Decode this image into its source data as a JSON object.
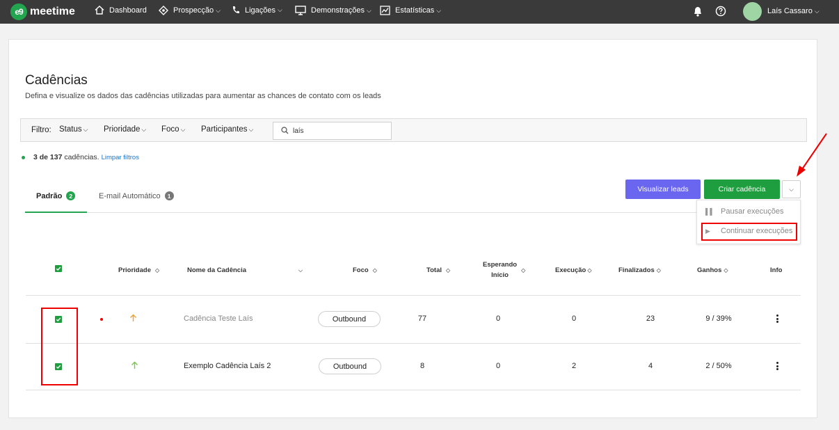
{
  "brand": {
    "logo_mark": "e9",
    "name": "meetime",
    "color": "#22a54e"
  },
  "nav": {
    "items": [
      {
        "label": "Dashboard",
        "icon": "home-icon",
        "has_dropdown": false
      },
      {
        "label": "Prospecção",
        "icon": "compass-icon",
        "has_dropdown": true
      },
      {
        "label": "Ligações",
        "icon": "phone-icon",
        "has_dropdown": true
      },
      {
        "label": "Demonstrações",
        "icon": "monitor-icon",
        "has_dropdown": true
      },
      {
        "label": "Estatísticas",
        "icon": "chart-icon",
        "has_dropdown": true
      }
    ],
    "user_name": "Laís Cassaro"
  },
  "page": {
    "title": "Cadências",
    "subtitle": "Defina e visualize os dados das cadências utilizadas para aumentar as chances de contato com os leads"
  },
  "filters": {
    "label": "Filtro:",
    "dropdowns": [
      "Status",
      "Prioridade",
      "Foco",
      "Participantes"
    ],
    "search_value": "laís"
  },
  "results": {
    "count_bold": "3 de 137",
    "count_text": " cadências.",
    "clear_link": "Limpar filtros"
  },
  "tabs": [
    {
      "label": "Padrão",
      "badge": "2",
      "active": true,
      "badge_color": "#22a54e"
    },
    {
      "label": "E-mail Automático",
      "badge": "1",
      "active": false,
      "badge_color": "#777777"
    }
  ],
  "actions": {
    "view_leads": "Visualizar leads",
    "create": "Criar cadência",
    "menu": [
      {
        "label": "Pausar execuções",
        "icon": "pause-icon"
      },
      {
        "label": "Continuar execuções",
        "icon": "play-icon"
      }
    ]
  },
  "table": {
    "columns": {
      "priority": "Prioridade",
      "name": "Nome da Cadência",
      "focus": "Foco",
      "total": "Total",
      "waiting_line1": "Esperando",
      "waiting_line2": "Início",
      "execution": "Execução",
      "finished": "Finalizados",
      "gains": "Ganhos",
      "info": "Info"
    },
    "rows": [
      {
        "name": "Cadência Teste Laís",
        "focus": "Outbound",
        "total": "77",
        "waiting": "0",
        "execution": "0",
        "finished": "23",
        "gains": "9 / 39%",
        "priority_color": "#f0a030",
        "muted": true,
        "alert_dot": true
      },
      {
        "name": "Exemplo Cadência Laís 2",
        "focus": "Outbound",
        "total": "8",
        "waiting": "0",
        "execution": "2",
        "finished": "4",
        "gains": "2 / 50%",
        "priority_color": "#7bc64a",
        "muted": false,
        "alert_dot": false
      }
    ]
  },
  "colors": {
    "topbar": "#3a3a3a",
    "primary_green": "#1e9e3e",
    "leads_purple": "#6a66f0",
    "highlight_red": "#e00000"
  }
}
